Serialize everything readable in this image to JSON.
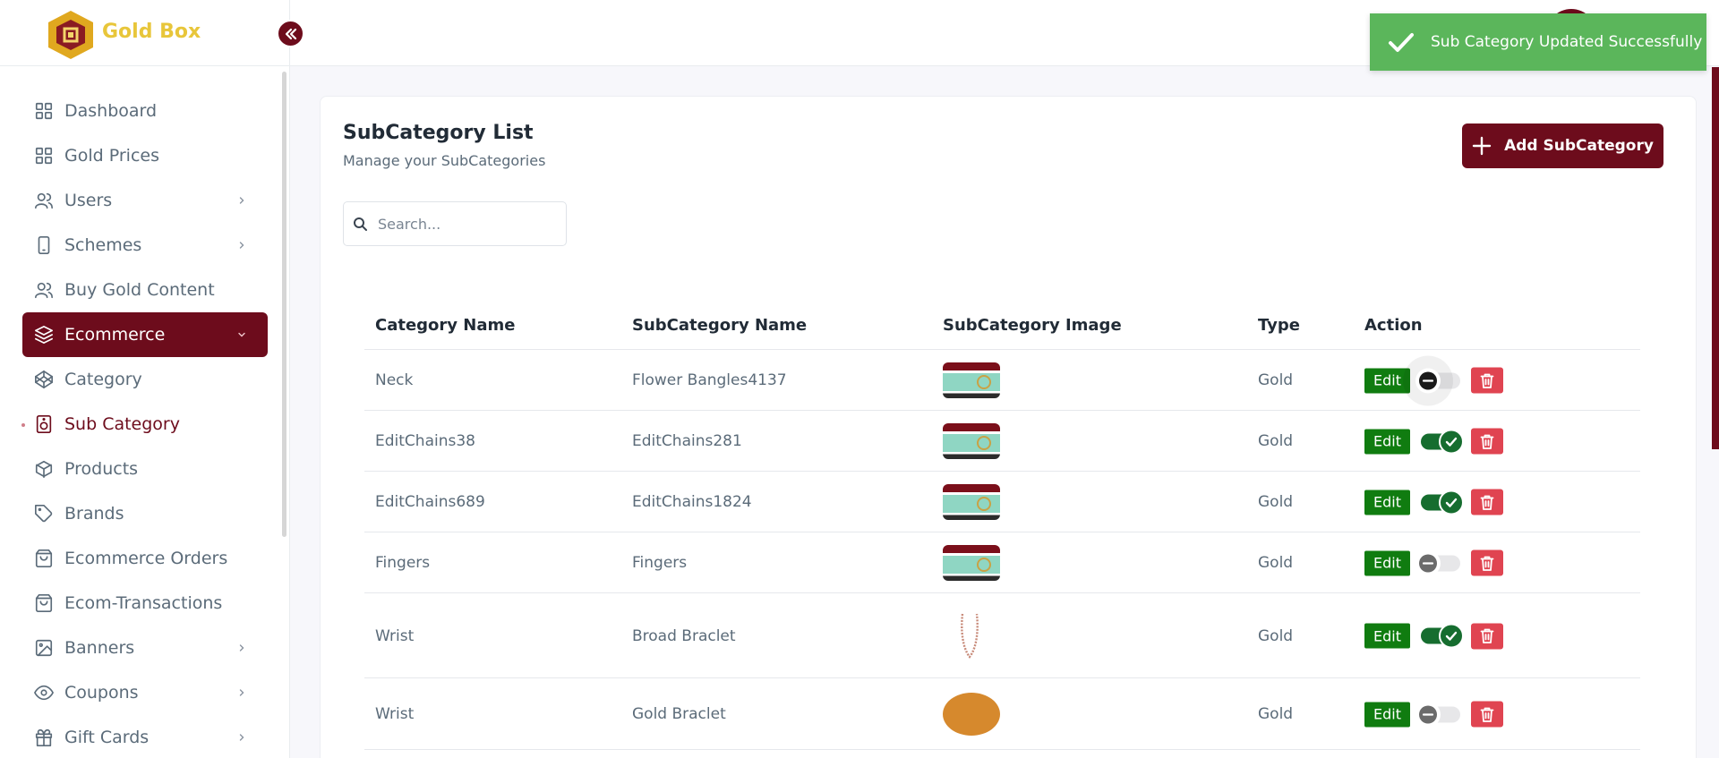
{
  "brand": {
    "name": "Gold Box"
  },
  "sidebar": {
    "items": [
      {
        "label": "Dashboard",
        "icon": "grid-icon",
        "chevron": false
      },
      {
        "label": "Gold Prices",
        "icon": "grid-icon",
        "chevron": false
      },
      {
        "label": "Users",
        "icon": "users-icon",
        "chevron": true
      },
      {
        "label": "Schemes",
        "icon": "phone-icon",
        "chevron": true
      },
      {
        "label": "Buy Gold Content",
        "icon": "users-icon",
        "chevron": false
      },
      {
        "label": "Ecommerce",
        "icon": "layers-icon",
        "chevron": true,
        "state": "active"
      },
      {
        "label": "Category",
        "icon": "codepen-icon",
        "chevron": false
      },
      {
        "label": "Sub Category",
        "icon": "speaker-icon",
        "chevron": false,
        "state": "current"
      },
      {
        "label": "Products",
        "icon": "box-icon",
        "chevron": false
      },
      {
        "label": "Brands",
        "icon": "tag-icon",
        "chevron": false
      },
      {
        "label": "Ecommerce Orders",
        "icon": "bag-icon",
        "chevron": false
      },
      {
        "label": "Ecom-Transactions",
        "icon": "bag-icon",
        "chevron": false
      },
      {
        "label": "Banners",
        "icon": "image-icon",
        "chevron": true
      },
      {
        "label": "Coupons",
        "icon": "eye-icon",
        "chevron": true
      },
      {
        "label": "Gift Cards",
        "icon": "gift-icon",
        "chevron": true
      }
    ]
  },
  "toast": {
    "message": "Sub Category Updated Successfully"
  },
  "page": {
    "title": "SubCategory List",
    "subtitle": "Manage your SubCategories",
    "add_button": "Add SubCategory"
  },
  "search": {
    "placeholder": "Search...",
    "value": ""
  },
  "table": {
    "headers": [
      "Category Name",
      "SubCategory Name",
      "SubCategory Image",
      "Type",
      "Action"
    ],
    "edit_label": "Edit",
    "rows": [
      {
        "category": "Neck",
        "subcategory": "Flower Bangles4137",
        "image": "banner",
        "type": "Gold",
        "active": false
      },
      {
        "category": "EditChains38",
        "subcategory": "EditChains281",
        "image": "banner",
        "type": "Gold",
        "active": true
      },
      {
        "category": "EditChains689",
        "subcategory": "EditChains1824",
        "image": "banner",
        "type": "Gold",
        "active": true
      },
      {
        "category": "Fingers",
        "subcategory": "Fingers",
        "image": "banner",
        "type": "Gold",
        "active": false
      },
      {
        "category": "Wrist",
        "subcategory": "Broad Braclet",
        "image": "chain",
        "type": "Gold",
        "active": true
      },
      {
        "category": "Wrist",
        "subcategory": "Gold Braclet",
        "image": "bracelet",
        "type": "Gold",
        "active": false
      }
    ]
  },
  "colors": {
    "primary": "#6d0c1c",
    "success": "#5bb65b",
    "edit": "#107c10",
    "danger": "#e04451",
    "brand_gold": "#e8c63a"
  }
}
